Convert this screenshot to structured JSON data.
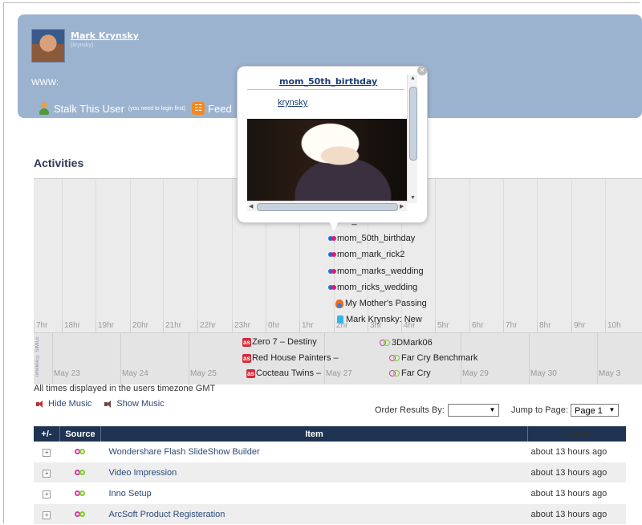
{
  "profile": {
    "name": "Mark Krynsky",
    "handle": "(krynsky)",
    "www_label": "WWW:",
    "stalk_label": "Stalk This User",
    "stalk_note": "(you need to login first)",
    "feed_label": "Feed"
  },
  "activities": {
    "title": "Activities",
    "hours": [
      "7hr",
      "18hr",
      "19hr",
      "20hr",
      "21hr",
      "22hr",
      "23hr",
      "0hr",
      "1hr",
      "2hr",
      "3hr",
      "4hr",
      "5hr",
      "6hr",
      "7hr",
      "8hr",
      "9hr",
      "10h"
    ],
    "days": [
      "May 23",
      "May 24",
      "May 25",
      "May 27",
      "May 29",
      "May 30",
      "May 3"
    ],
    "credit": "Timeline © SIMILE",
    "events": [
      {
        "label": "100_0870"
      },
      {
        "label": "mom_50th_birthday"
      },
      {
        "label": "mom_mark_rick2"
      },
      {
        "label": "mom_marks_wedding"
      },
      {
        "label": "mom_ricks_wedding"
      },
      {
        "label": "My Mother's Passing"
      },
      {
        "label": "Mark Krynsky: New"
      }
    ],
    "lower_events": [
      {
        "label": "Zero 7 – Destiny",
        "source": "lastfm"
      },
      {
        "label": "Red House Painters –",
        "source": "lastfm"
      },
      {
        "label": "Cocteau Twins –",
        "source": "lastfm"
      },
      {
        "label": "3DMark06",
        "source": "ng"
      },
      {
        "label": "Far Cry Benchmark",
        "source": "ng"
      },
      {
        "label": "Far Cry",
        "source": "ng"
      }
    ],
    "popup": {
      "title": "mom_50th_birthday",
      "user": "krynsky"
    },
    "timezone_note": "All times displayed in the users timezone GMT",
    "hide_music": "Hide Music",
    "show_music": "Show Music",
    "order_label": "Order Results By:",
    "order_value": "",
    "jump_label": "Jump to Page:",
    "jump_value": "Page 1"
  },
  "table": {
    "headers": [
      "+/-",
      "Source",
      "Item",
      "When"
    ],
    "rows": [
      {
        "item": "Wondershare Flash SlideShow Builder",
        "when": "about 13 hours ago"
      },
      {
        "item": "Video Impression",
        "when": "about 13 hours ago"
      },
      {
        "item": "Inno Setup",
        "when": "about 13 hours ago"
      },
      {
        "item": "ArcSoft Product Registeration",
        "when": "about 13 hours ago"
      }
    ]
  },
  "colors": {
    "profile_bg": "#9cb3d0",
    "table_header_bg": "#1f3353",
    "link": "#1a3b75"
  }
}
